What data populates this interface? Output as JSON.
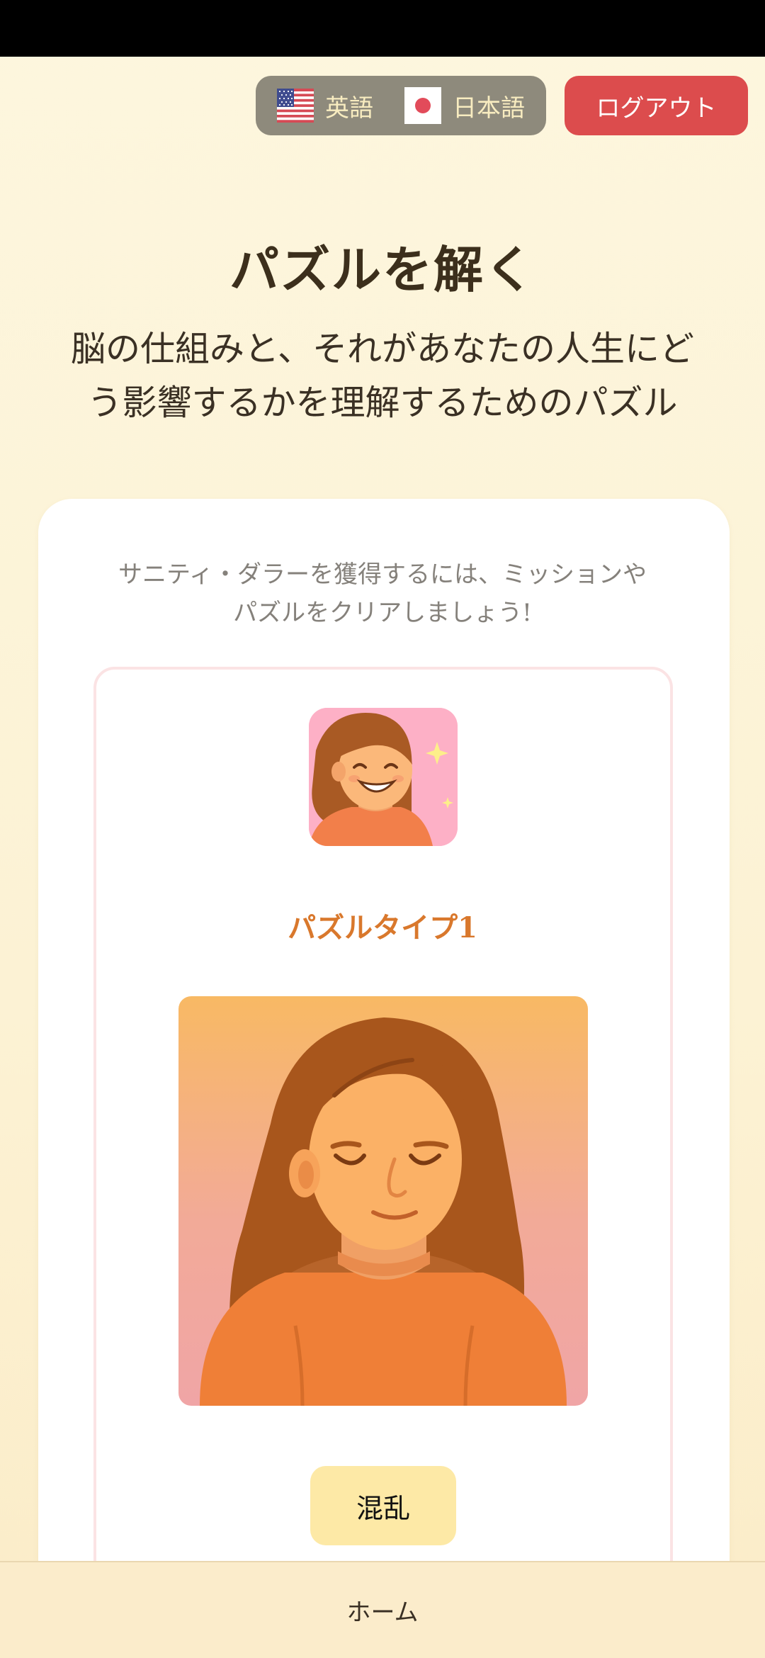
{
  "language_toggle": {
    "english_label": "英語",
    "english_flag_icon": "us-flag-icon",
    "japanese_label": "日本語",
    "japanese_flag_icon": "jp-flag-icon"
  },
  "header": {
    "logout_label": "ログアウト"
  },
  "main": {
    "title": "パズルを解く",
    "subtitle_line1": "脳の仕組みと、それがあなたの人生にど",
    "subtitle_line2": "う影響するかを理解するためのパズル"
  },
  "card": {
    "hint_line1": "サニティ・ダラーを獲得するには、ミッションや",
    "hint_line2": "パズルをクリアしましょう!",
    "puzzle": {
      "type_label": "パズルタイプ1",
      "shuffle_label": "混乱"
    }
  },
  "bottom_nav": {
    "home_label": "ホーム"
  },
  "colors": {
    "page_background": "#fdf6de",
    "logout_button": "#dc4c4d",
    "language_toggle": "#8e8a7c",
    "puzzle_type_text": "#d9782c",
    "shuffle_button": "#fde9a6",
    "card_border": "#fbe3e4"
  }
}
